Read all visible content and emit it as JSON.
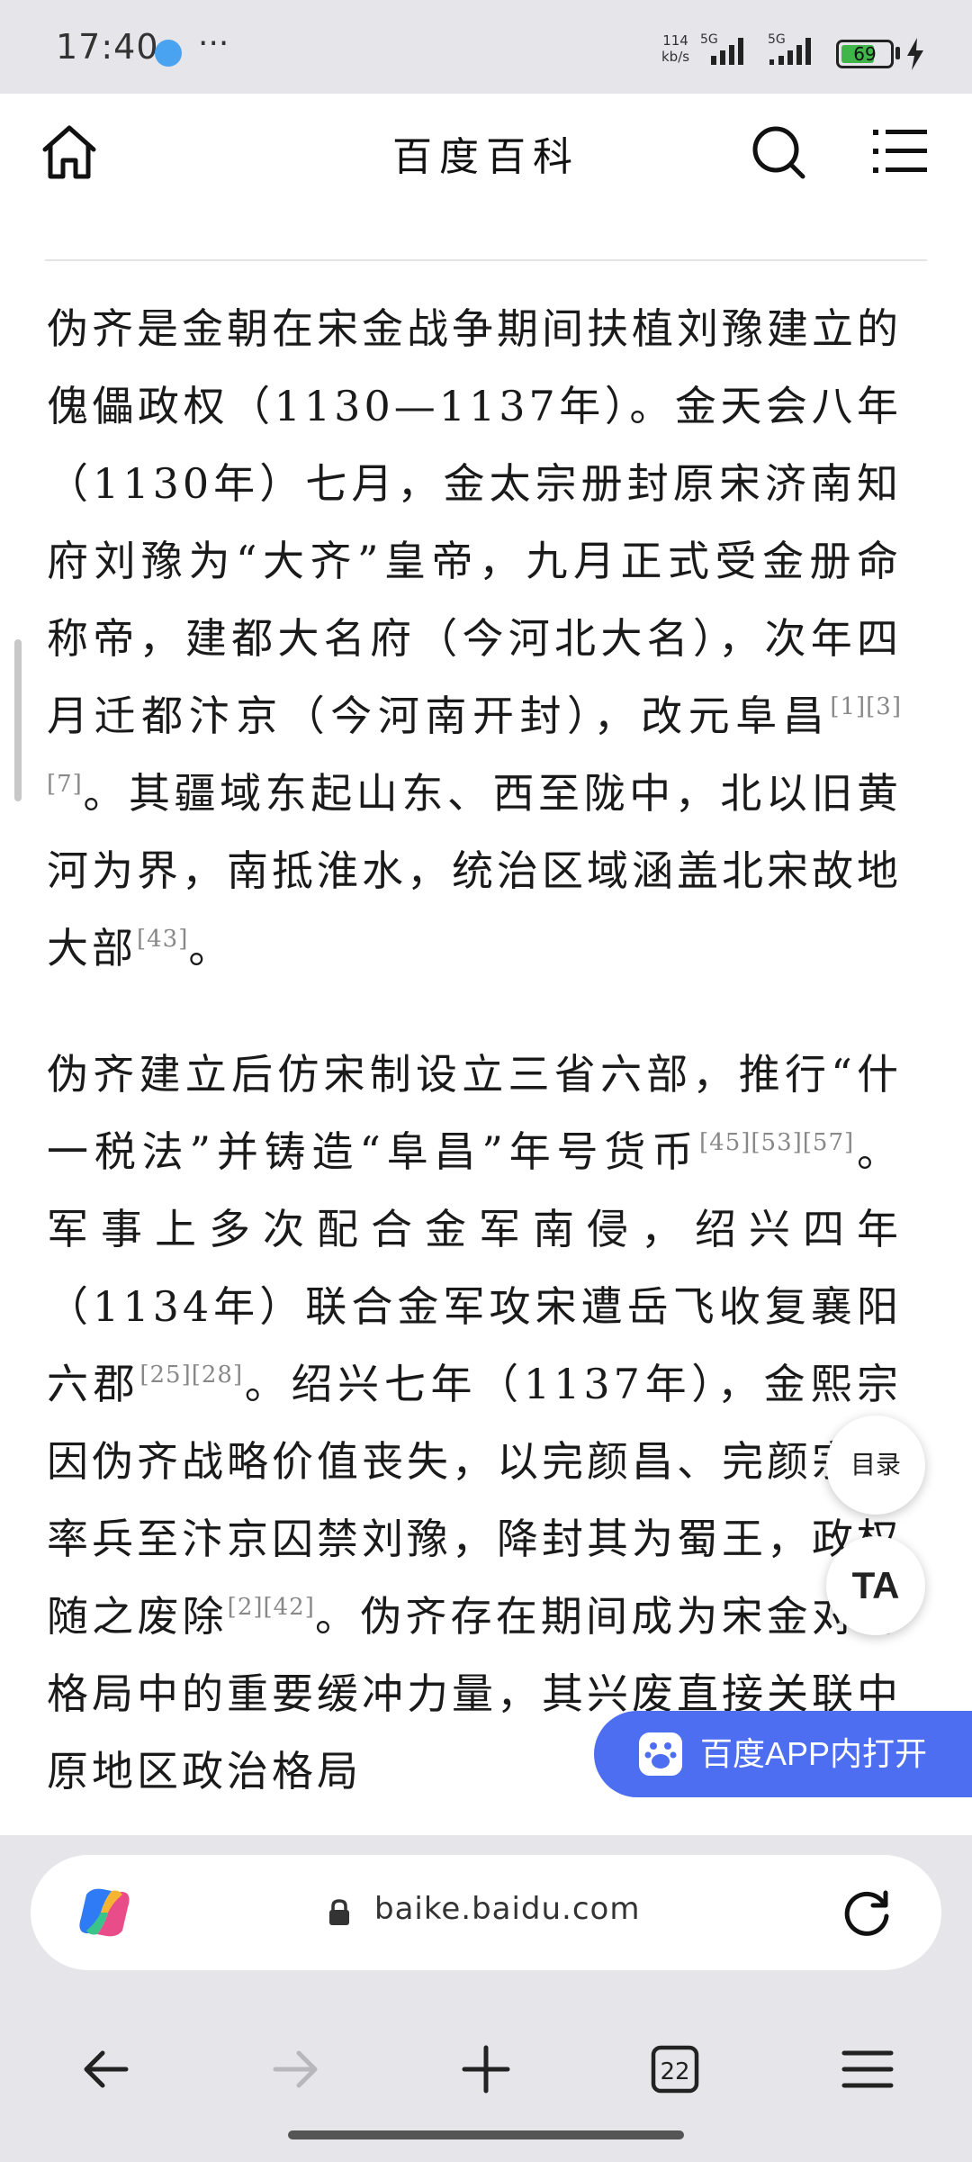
{
  "status_bar": {
    "time": "17:40",
    "more": "···",
    "net_speed_value": "114",
    "net_speed_unit": "kb/s",
    "signal1_label": "5G",
    "signal2_label": "5G",
    "battery_level": 69,
    "battery_text": "69"
  },
  "header": {
    "title": "百度百科"
  },
  "article": {
    "cut_text": "",
    "para1": {
      "text_a": "伪齐是金朝在宋金战争期间扶植刘豫建立的傀儡政权（1130—1137年）。金天会八年（1130年）七月，金太宗册封原宋济南知府刘豫为“大齐”皇帝，九月正式受金册命称帝，建都大名府（今河北大名），次年四月迁都汴京（今河南开封），改元阜昌",
      "cite_a": "[1][3][7]",
      "text_b": "。其疆域东起山东、西至陇中，北以旧黄河为界，南抵淮水，统治区域涵盖北宋故地大部",
      "cite_b": "[43]",
      "text_c": "。"
    },
    "para2": {
      "text_a": "伪齐建立后仿宋制设立三省六部，推行“什一税法”并铸造“阜昌”年号货币",
      "cite_a": "[45][53][57]",
      "text_b": "。军事上多次配合金军南侵，绍兴四年（1134年）联合金军攻宋遭岳飞收复襄阳六郡",
      "cite_b": "[25][28]",
      "text_c": "。绍兴七年（1137年），金熙宗因伪齐战略价值丧失，以完颜昌、完颜宗弼率兵至汴京囚禁刘豫，降封其为蜀王，政权随之废除",
      "cite_c": "[2][42]",
      "text_d": "。伪齐存在期间成为宋金对峙格局中的重要缓冲力量，其兴废直接关联中原地区政治格局"
    }
  },
  "floating": {
    "toc_label": "目录",
    "ta_label": "TA",
    "open_app_label": "百度APP内打开"
  },
  "browser": {
    "url": "baike.baidu.com",
    "tab_count": "22"
  },
  "colors": {
    "accent": "#4e6ef2",
    "battery_green": "#3fb54a"
  },
  "icons": [
    "home-icon",
    "search-icon",
    "menu-icon",
    "copilot-icon",
    "lock-icon",
    "reload-icon",
    "back-icon",
    "forward-icon",
    "plus-icon",
    "tabs-icon",
    "hamburger-icon"
  ]
}
